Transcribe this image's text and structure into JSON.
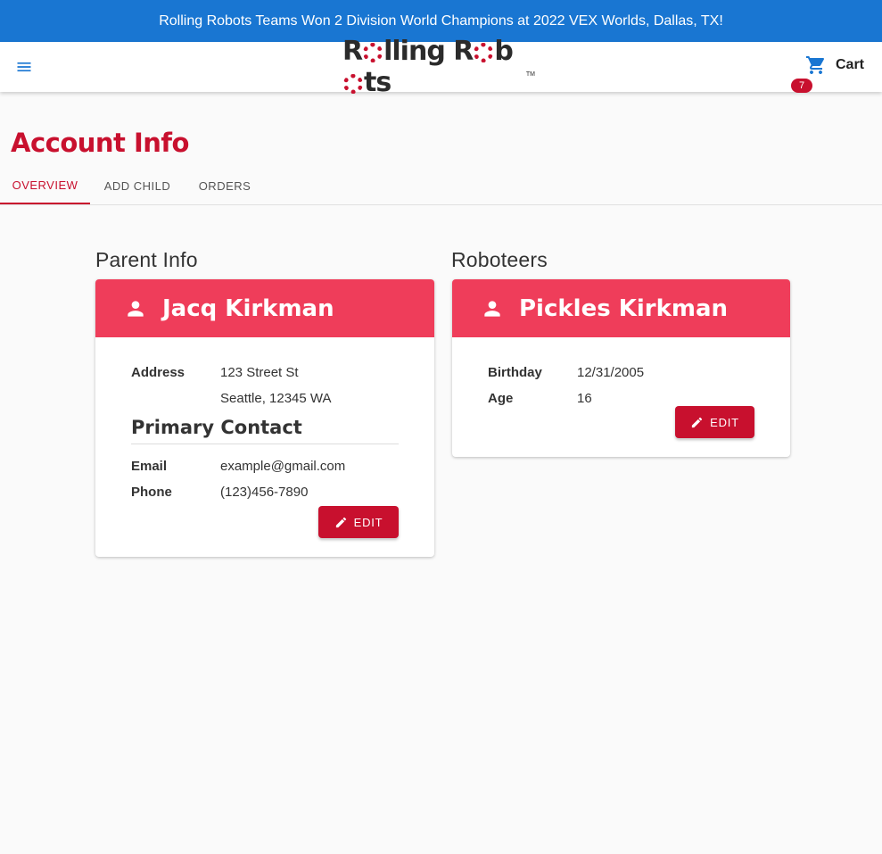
{
  "banner": {
    "text": "Rolling Robots Teams Won 2 Division World Champions at 2022 VEX Worlds, Dallas, TX!"
  },
  "header": {
    "menu_icon": "menu-icon",
    "logo": {
      "part1": "R",
      "part2": "lling R",
      "part3": "b",
      "part4": "ts",
      "tm": "TM"
    },
    "cart": {
      "label": "Cart",
      "icon": "cart-icon",
      "badge": "7"
    }
  },
  "page": {
    "title": "Account Info"
  },
  "tabs": [
    {
      "label": "OVERVIEW",
      "active": true
    },
    {
      "label": "ADD CHILD",
      "active": false
    },
    {
      "label": "ORDERS",
      "active": false
    }
  ],
  "parent_section": {
    "title": "Parent Info",
    "name": "Jacq Kirkman",
    "address_label": "Address",
    "address_line1": "123 Street St",
    "address_line2": "Seattle, 12345 WA",
    "contact_heading": "Primary Contact",
    "email_label": "Email",
    "email": "example@gmail.com",
    "phone_label": "Phone",
    "phone": "(123)456-7890",
    "edit_label": "EDIT"
  },
  "roboteers_section": {
    "title": "Roboteers",
    "name": "Pickles Kirkman",
    "birthday_label": "Birthday",
    "birthday": "12/31/2005",
    "age_label": "Age",
    "age": "16",
    "edit_label": "EDIT"
  },
  "colors": {
    "brand_red": "#c8102e",
    "card_header": "#ef3d5a",
    "banner_blue": "#1976d2"
  }
}
